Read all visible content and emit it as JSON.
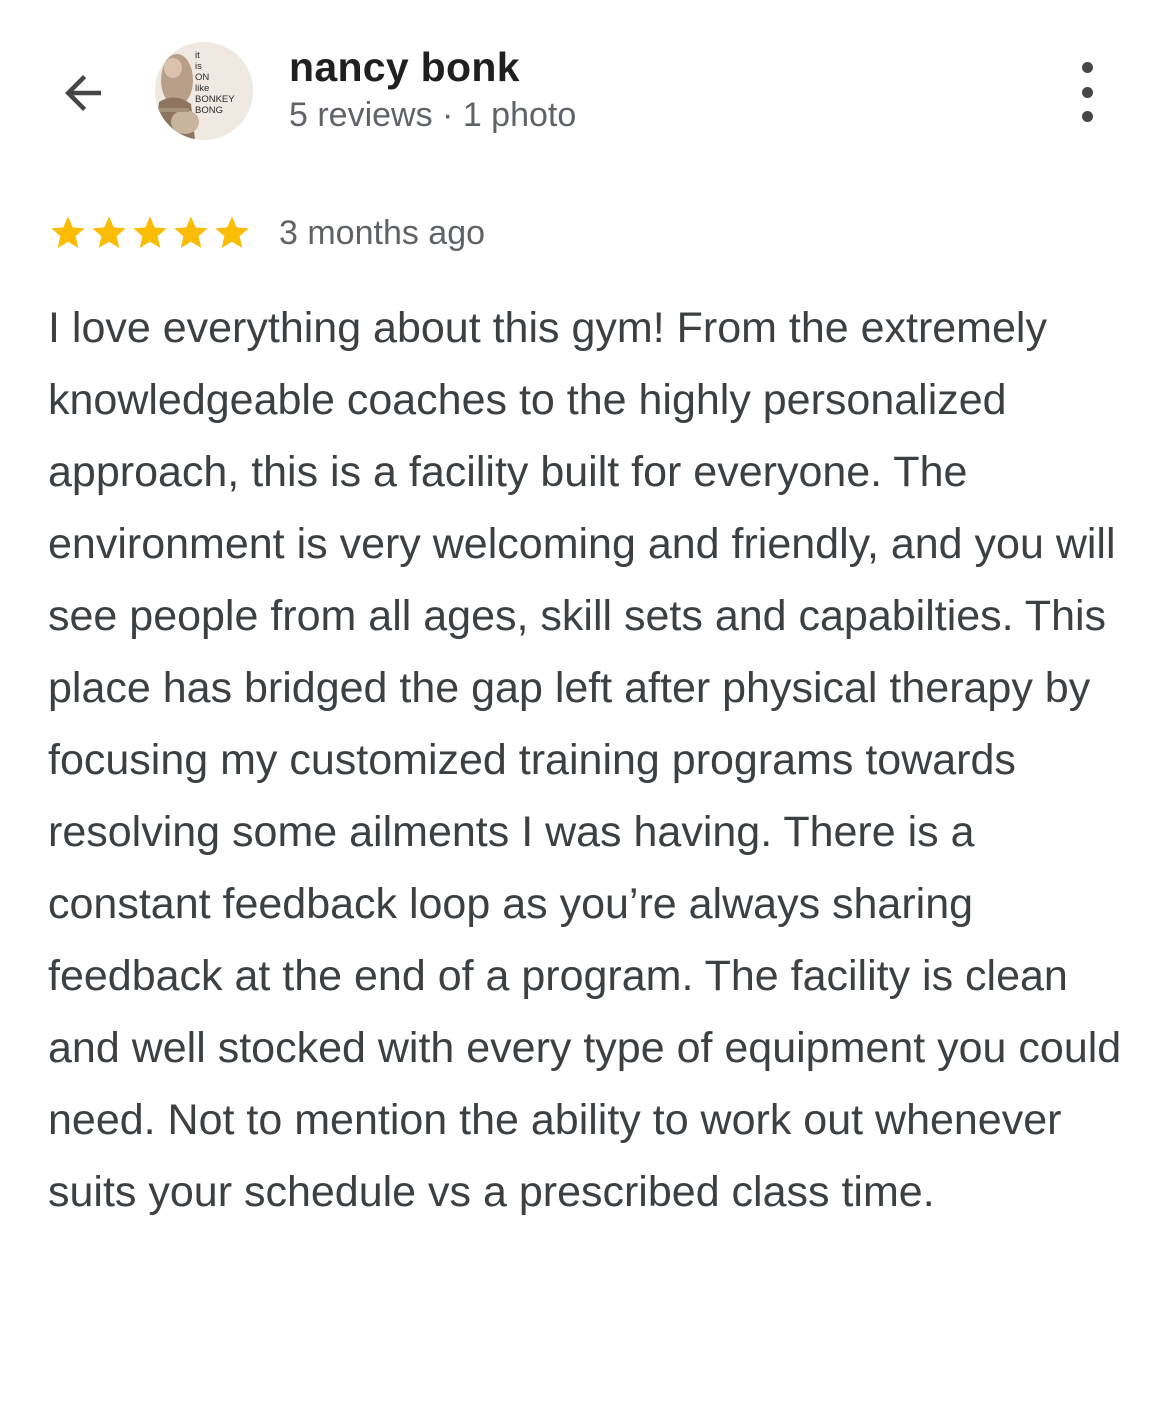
{
  "header": {
    "back_icon": "arrow-left-icon",
    "reviewer_name": "nancy bonk",
    "reviewer_meta": "5 reviews · 1 photo",
    "more_icon": "more-vert-icon",
    "avatar_text": [
      "it",
      "is",
      "ON",
      "like",
      "BONKEY",
      "BONG"
    ]
  },
  "review": {
    "rating": 5,
    "max_rating": 5,
    "star_icon": "star-icon",
    "star_color": "#fbbc04",
    "time_ago": "3 months ago",
    "text": "I love everything about this gym! From the extremely knowledgeable coaches to the highly personalized approach, this is a facility built for everyone. The environment is very welcoming and friendly, and you will see people from all ages, skill sets and capabilties. This place has bridged the gap left after physical therapy by focusing my customized training programs towards resolving some ailments I was having. There is a constant feedback loop as you’re always sharing feedback at the end of a program. The facility is clean and well stocked with every type of equipment you could need. Not to mention the ability to work out whenever suits your schedule vs a prescribed class time."
  }
}
